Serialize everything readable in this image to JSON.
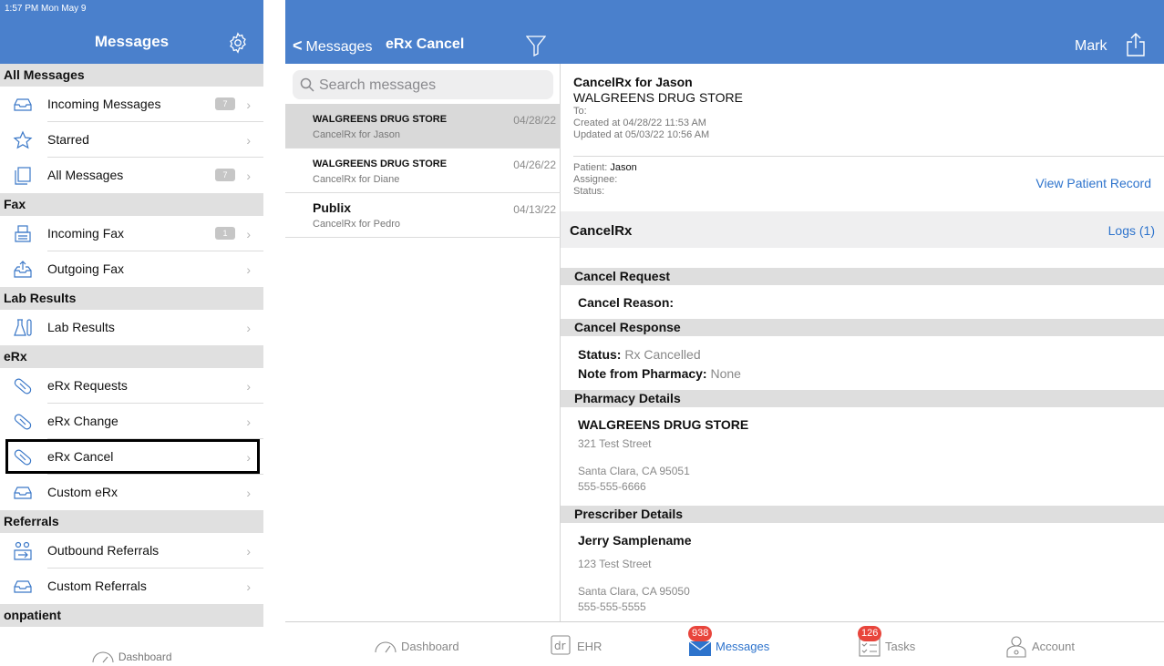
{
  "status_bar": {
    "time": "1:57 PM  Mon May 9"
  },
  "sidebar": {
    "title": "Messages",
    "sections": [
      {
        "title": "All Messages",
        "items": [
          {
            "label": "Incoming Messages",
            "icon": "inbox-tray-icon",
            "badge": "7"
          },
          {
            "label": "Starred",
            "icon": "star-icon",
            "badge": ""
          },
          {
            "label": "All Messages",
            "icon": "stacked-pages-icon",
            "badge": "7"
          }
        ]
      },
      {
        "title": "Fax",
        "items": [
          {
            "label": "Incoming Fax",
            "icon": "fax-machine-icon",
            "badge": "1"
          },
          {
            "label": "Outgoing Fax",
            "icon": "outbox-icon",
            "badge": ""
          }
        ]
      },
      {
        "title": "Lab Results",
        "items": [
          {
            "label": "Lab Results",
            "icon": "lab-flask-icon",
            "badge": ""
          }
        ]
      },
      {
        "title": "eRx",
        "items": [
          {
            "label": "eRx Requests",
            "icon": "pill-icon",
            "badge": ""
          },
          {
            "label": "eRx Change",
            "icon": "pill-icon",
            "badge": ""
          },
          {
            "label": "eRx Cancel",
            "icon": "pill-icon",
            "badge": "",
            "selected": true
          },
          {
            "label": "Custom eRx",
            "icon": "inbox-tray-icon",
            "badge": ""
          }
        ]
      },
      {
        "title": "Referrals",
        "items": [
          {
            "label": "Outbound Referrals",
            "icon": "referral-people-icon",
            "badge": ""
          },
          {
            "label": "Custom Referrals",
            "icon": "inbox-tray-icon",
            "badge": ""
          }
        ]
      },
      {
        "title": "onpatient",
        "items": []
      }
    ],
    "dashboard_label": "Dashboard"
  },
  "middle": {
    "back_label": "Messages",
    "title": "eRx Cancel",
    "search_placeholder": "Search messages",
    "messages": [
      {
        "from": "WALGREENS DRUG STORE",
        "subject": "CancelRx for Jason",
        "date": "04/28/22",
        "selected": true
      },
      {
        "from": "WALGREENS DRUG STORE",
        "subject": "CancelRx for Diane",
        "date": "04/26/22"
      },
      {
        "from": "Publix",
        "subject": "CancelRx for Pedro",
        "date": "04/13/22"
      }
    ]
  },
  "detail": {
    "mark_label": "Mark",
    "title": "CancelRx for Jason",
    "from": "WALGREENS DRUG STORE",
    "to": "To:",
    "created": "Created at 04/28/22 11:53 AM",
    "updated": "Updated at 05/03/22 10:56 AM",
    "patient_label": "Patient:",
    "patient_name": "Jason",
    "assignee_label": "Assignee:",
    "status_label": "Status:",
    "view_patient_record": "View Patient Record",
    "cancelrx_title": "CancelRx",
    "logs_label": "Logs (1)",
    "cancel_request_title": "Cancel Request",
    "cancel_reason_label": "Cancel Reason:",
    "cancel_response_title": "Cancel Response",
    "response_status_label": "Status:",
    "response_status_value": "Rx Cancelled",
    "note_label": "Note from Pharmacy:",
    "note_value": "None",
    "pharmacy_title": "Pharmacy Details",
    "pharmacy_name": "WALGREENS DRUG STORE",
    "pharmacy_street": "321 Test Street",
    "pharmacy_city": "Santa Clara, CA 95051",
    "pharmacy_phone": "555-555-6666",
    "prescriber_title": "Prescriber Details",
    "prescriber_name": "Jerry Samplename",
    "prescriber_street": "123 Test Street",
    "prescriber_city": "Santa Clara, CA 95050",
    "prescriber_phone": "555-555-5555"
  },
  "tabbar": {
    "tabs": [
      {
        "label": "Dashboard",
        "icon": "gauge-icon",
        "badge": ""
      },
      {
        "label": "EHR",
        "icon": "dr-logo-icon",
        "badge": ""
      },
      {
        "label": "Messages",
        "icon": "envelope-icon",
        "badge": "938",
        "active": true
      },
      {
        "label": "Tasks",
        "icon": "checklist-icon",
        "badge": "126"
      },
      {
        "label": "Account",
        "icon": "doctor-person-icon",
        "badge": ""
      }
    ]
  },
  "colors": {
    "header_blue": "#4a80cc",
    "link_blue": "#2d73cc",
    "badge_red": "#e8453c"
  }
}
